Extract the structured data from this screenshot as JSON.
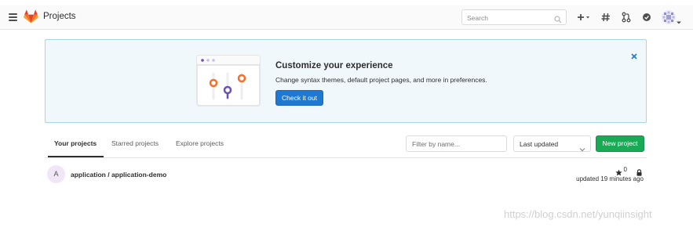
{
  "navbar": {
    "title": "Projects",
    "search_placeholder": "Search",
    "icons": [
      "plus-icon",
      "todo-hash-icon",
      "merge-request-icon",
      "issues-check-icon",
      "avatar"
    ]
  },
  "banner": {
    "title": "Customize your experience",
    "text": "Change syntax themes, default project pages, and more in preferences.",
    "button_label": "Check it out"
  },
  "tabs": [
    {
      "label": "Your projects",
      "active": true
    },
    {
      "label": "Starred projects",
      "active": false
    },
    {
      "label": "Explore projects",
      "active": false
    }
  ],
  "filter": {
    "placeholder": "Filter by name..."
  },
  "sort": {
    "selected": "Last updated"
  },
  "new_project_label": "New project",
  "projects": [
    {
      "avatar_letter": "A",
      "name": "application / application-demo",
      "stars": "0",
      "visibility": "private",
      "updated": "updated 19 minutes ago"
    }
  ],
  "watermark": "https://blog.csdn.net/yunqiinsight",
  "colors": {
    "primary_button": "#1f78d1",
    "success_button": "#1aaa55",
    "banner_bg": "#f0f8fc",
    "banner_border": "#a6d6ea",
    "gitlab_orange": "#e24329"
  }
}
